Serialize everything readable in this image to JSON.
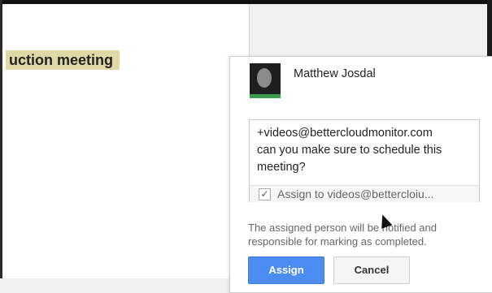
{
  "document": {
    "highlighted_text": "uction meeting"
  },
  "comment": {
    "user_name": "Matthew Josdal",
    "text_line1": "+videos@bettercloudmonitor.com",
    "text_line2": "can you make sure to schedule this",
    "text_line3": "meeting?",
    "assign_checked": true,
    "assign_label": "Assign to videos@bettercloiu...",
    "help_line1": "The assigned person will be notified and",
    "help_line2": "responsible for marking as completed.",
    "assign_button": "Assign",
    "cancel_button": "Cancel"
  },
  "icons": {
    "avatar": "user-avatar",
    "checkbox": "checkmark-icon",
    "cursor": "mouse-pointer-icon"
  },
  "colors": {
    "highlight": "#e0d8a6",
    "assign_button": "#4d8cf0",
    "avatar_accent": "#3a9c4a"
  }
}
